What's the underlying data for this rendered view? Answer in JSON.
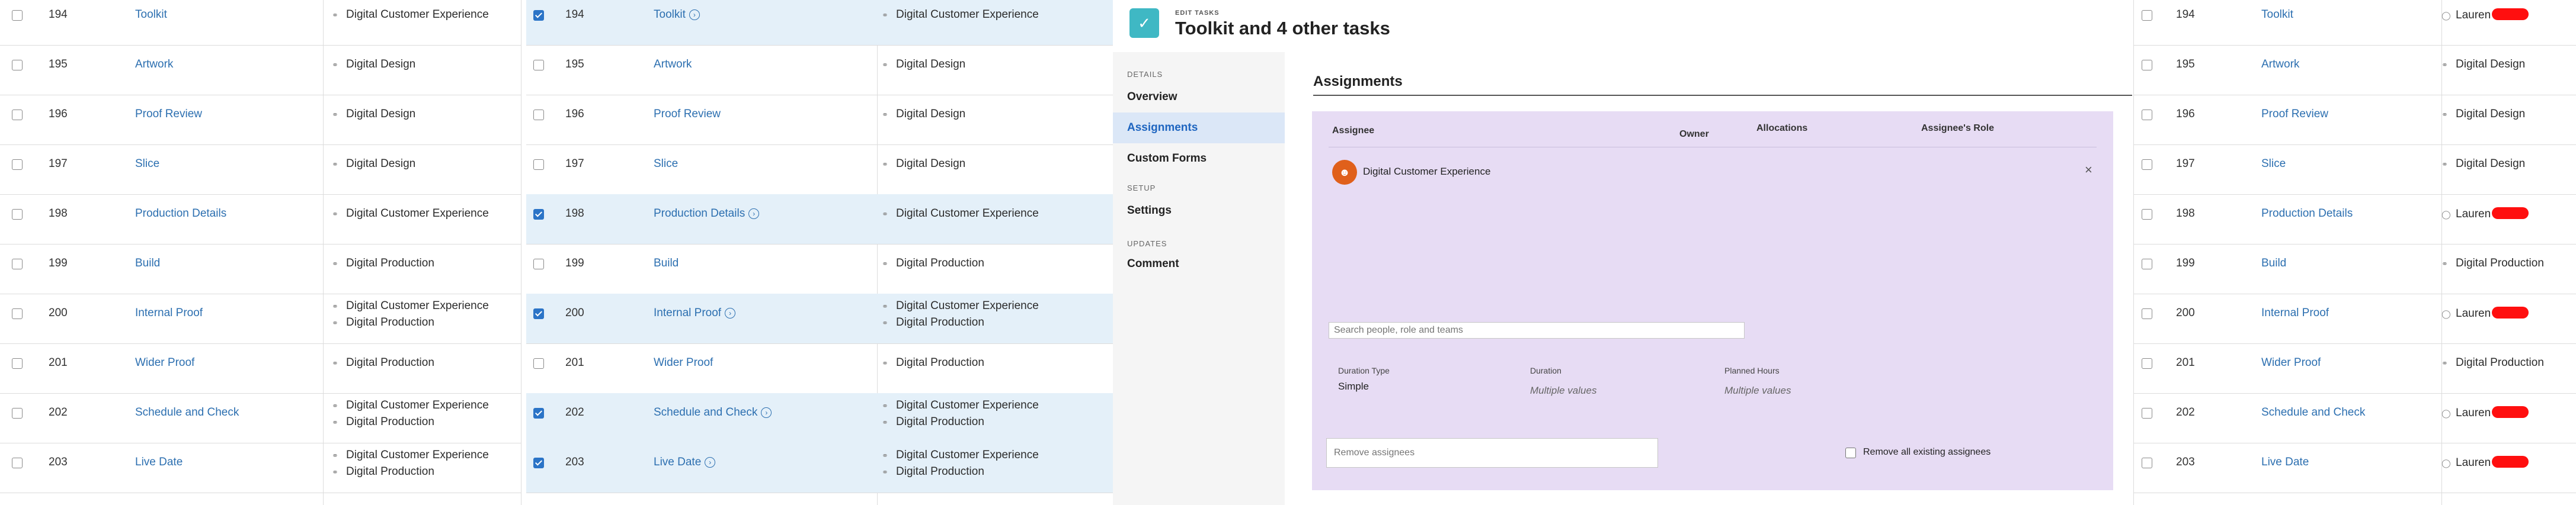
{
  "tasks": [
    {
      "num": "194",
      "name": "Toolkit",
      "selected": true,
      "assignments": [
        "Digital Customer Experience"
      ],
      "p4_assignment": {
        "type": "person",
        "text": "Lauren"
      }
    },
    {
      "num": "195",
      "name": "Artwork",
      "selected": false,
      "assignments": [
        "Digital Design"
      ],
      "p4_assignment": {
        "type": "team",
        "text": "Digital Design"
      }
    },
    {
      "num": "196",
      "name": "Proof Review",
      "selected": false,
      "assignments": [
        "Digital Design"
      ],
      "p4_assignment": {
        "type": "team",
        "text": "Digital Design"
      }
    },
    {
      "num": "197",
      "name": "Slice",
      "selected": false,
      "assignments": [
        "Digital Design"
      ],
      "p4_assignment": {
        "type": "team",
        "text": "Digital Design"
      }
    },
    {
      "num": "198",
      "name": "Production Details",
      "selected": true,
      "assignments": [
        "Digital Customer Experience"
      ],
      "p4_assignment": {
        "type": "person",
        "text": "Lauren"
      }
    },
    {
      "num": "199",
      "name": "Build",
      "selected": false,
      "assignments": [
        "Digital Production"
      ],
      "p4_assignment": {
        "type": "team",
        "text": "Digital Production"
      }
    },
    {
      "num": "200",
      "name": "Internal Proof",
      "selected": true,
      "assignments": [
        "Digital Customer Experience",
        "Digital Production"
      ],
      "p4_assignment": {
        "type": "person",
        "text": "Lauren"
      }
    },
    {
      "num": "201",
      "name": "Wider Proof",
      "selected": false,
      "assignments": [
        "Digital Production"
      ],
      "p4_assignment": {
        "type": "team",
        "text": "Digital Production"
      }
    },
    {
      "num": "202",
      "name": "Schedule and Check",
      "selected": true,
      "assignments": [
        "Digital Customer Experience",
        "Digital Production"
      ],
      "p4_assignment": {
        "type": "person",
        "text": "Lauren"
      }
    },
    {
      "num": "203",
      "name": "Live Date",
      "selected": true,
      "assignments": [
        "Digital Customer Experience",
        "Digital Production"
      ],
      "p4_assignment": {
        "type": "person",
        "text": "Lauren"
      }
    }
  ],
  "dialog": {
    "eyebrow": "EDIT TASKS",
    "title": "Toolkit and 4 other tasks",
    "nav": {
      "details_section": "DETAILS",
      "overview": "Overview",
      "assignments": "Assignments",
      "custom_forms": "Custom Forms",
      "setup_section": "SETUP",
      "settings": "Settings",
      "updates_section": "UPDATES",
      "comment": "Comment"
    },
    "section_title": "Assignments",
    "columns": {
      "assignee": "Assignee",
      "owner": "Owner",
      "allocations": "Allocations",
      "role": "Assignee's Role"
    },
    "assignee": "Digital Customer Experience",
    "search_placeholder": "Search people, role and teams",
    "duration_type_label": "Duration Type",
    "duration_type_value": "Simple",
    "duration_label": "Duration",
    "duration_value": "Multiple values",
    "planned_hours_label": "Planned Hours",
    "planned_hours_value": "Multiple values",
    "remove_placeholder": "Remove assignees",
    "remove_all_label": "Remove all existing assignees"
  },
  "colors": {
    "link": "#2c6fb0",
    "selected_row": "#e4f0f9",
    "assignments_bg": "#e7dcf4",
    "app_icon": "#3fb8c4",
    "avatar": "#e0601b",
    "redaction": "#ff0f0f"
  },
  "icons": {
    "team": "team-icon",
    "person": "person-icon",
    "remove": "close-icon",
    "app": "clipboard-check-icon",
    "task_open": "arrow-circle-right-icon"
  }
}
